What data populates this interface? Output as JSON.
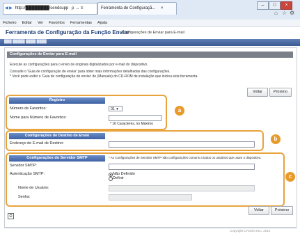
{
  "browser": {
    "address": "http://████████/sendsupp",
    "address_tools": "ρ → ≡",
    "tab_title": "Ferramenta de Configuraçã...",
    "tab_close": "×",
    "home_icon": "⌂",
    "star_icon": "☆",
    "gear_icon": "⚙",
    "back_icon": "◀",
    "forward_icon": "▶",
    "minimize": "–",
    "maximize": "□",
    "close": "×",
    "menu": [
      "Ficheiro",
      "Editar",
      "Ver",
      "Favoritos",
      "Ferramentas",
      "Ajuda"
    ]
  },
  "header": {
    "title": "Ferramenta de Configuração da Função Enviar",
    "subtitle": "Configurações de Enviar para E-mail",
    "crumb": "███ █████ ████ ████"
  },
  "section": {
    "title": "Configurações de Enviar para E-mail",
    "note1": "Execute as configurações para o envio de originais digitalizados por e-mail do dispositivo.",
    "note2": "Consulte o 'Guia de configuração de enviar' para obter mais informações detalhadas das configurações.",
    "note3": "* Você pode exibir o 'Guia de configuração de enviar' do (Manuals) do CD-ROM de instalação que iniciou esta ferramenta."
  },
  "buttons": {
    "back": "Voltar",
    "next": "Próximo"
  },
  "registro": {
    "title": "Registro",
    "favorites_label": "Número de Favoritos:",
    "favorites_value": "01",
    "name_label": "Nome para Número de Favoritos:",
    "name_value": "",
    "name_hint": "* 16 Caracteres, no Máximo",
    "callout": "a"
  },
  "destino": {
    "title": "Configurações de Destino de Envio",
    "email_label": "Endereço de E-mail de Destino:",
    "email_value": "",
    "callout": "b"
  },
  "smtp": {
    "title": "Configurações do Servidor SMTP",
    "note": "* As Configurações de Servidor SMTP são configurações comuns a todos os usuários que usam o dispositivo.",
    "server_label": "Servidor SMTP:",
    "server_value": "",
    "auth_label": "Autenticação SMTP:",
    "auth_options": [
      "Não Definido",
      "Definir"
    ],
    "auth_selected": "Não Definido",
    "username_label": "Nome de Usuário:",
    "password_label": "Senha:",
    "callout": "c"
  },
  "footer": {
    "copyright": "Copyright CANON INC. 2014"
  }
}
